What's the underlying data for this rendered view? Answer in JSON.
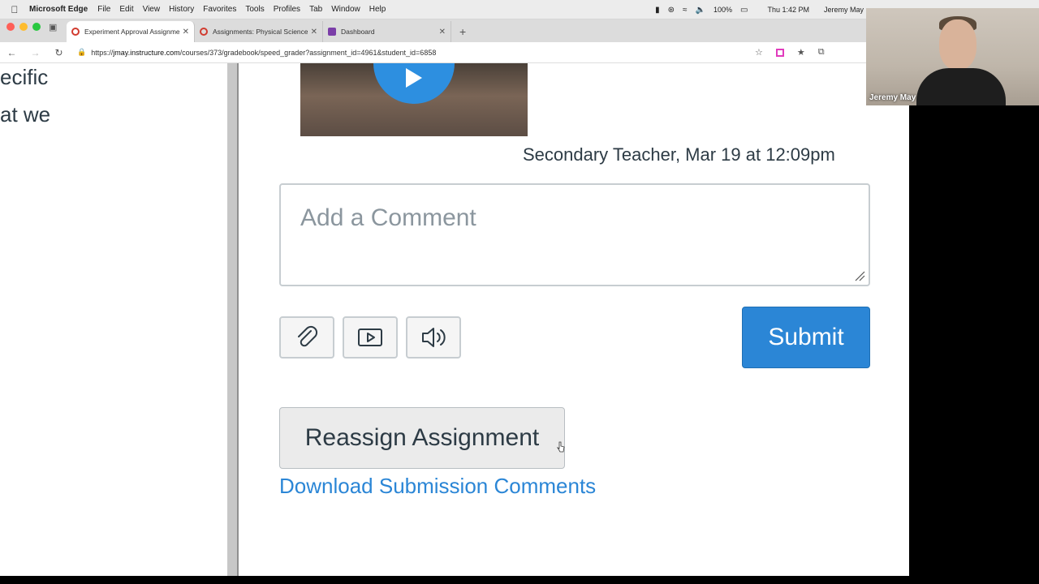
{
  "menubar": {
    "app_name": "Microsoft Edge",
    "menus": [
      "File",
      "Edit",
      "View",
      "History",
      "Favorites",
      "Tools",
      "Profiles",
      "Tab",
      "Window",
      "Help"
    ],
    "battery": "100%",
    "clock": "Thu 1:42 PM",
    "user": "Jeremy May"
  },
  "tabs": [
    {
      "label": "Experiment Approval Assignme"
    },
    {
      "label": "Assignments: Physical Science"
    },
    {
      "label": "Dashboard"
    }
  ],
  "address_bar": {
    "url_host": "jmay.instructure.com",
    "url_prefix": "https://",
    "url_path": "/courses/373/gradebook/speed_grader?assignment_id=4961&student_id=6858"
  },
  "left_pane": {
    "line1": "ecific",
    "line2": "at we"
  },
  "comment": {
    "meta": "Secondary Teacher, Mar 19 at 12:09pm",
    "placeholder": "Add a Comment"
  },
  "buttons": {
    "submit": "Submit",
    "reassign": "Reassign Assignment",
    "download_link": "Download Submission Comments"
  },
  "webcam": {
    "name": "Jeremy May"
  },
  "colors": {
    "accent": "#2b86d6",
    "text": "#2d3b45"
  }
}
